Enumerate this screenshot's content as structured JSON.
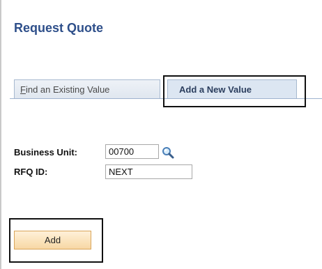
{
  "page": {
    "title": "Request Quote"
  },
  "tabs": {
    "find_hotkey": "F",
    "find_rest": "ind an Existing Value",
    "add_label": "Add a New Value"
  },
  "form": {
    "business_unit_label": "Business Unit:",
    "business_unit_value": "00700",
    "rfq_id_label": "RFQ ID:",
    "rfq_id_value": "NEXT"
  },
  "actions": {
    "add_label": "Add"
  },
  "icons": {
    "lookup": "magnifier-icon"
  },
  "colors": {
    "title": "#2e4f8a",
    "tab_active_bg": "#dce6f2",
    "add_button_bg": "#f7d7a4",
    "add_button_border": "#d9a55a"
  }
}
